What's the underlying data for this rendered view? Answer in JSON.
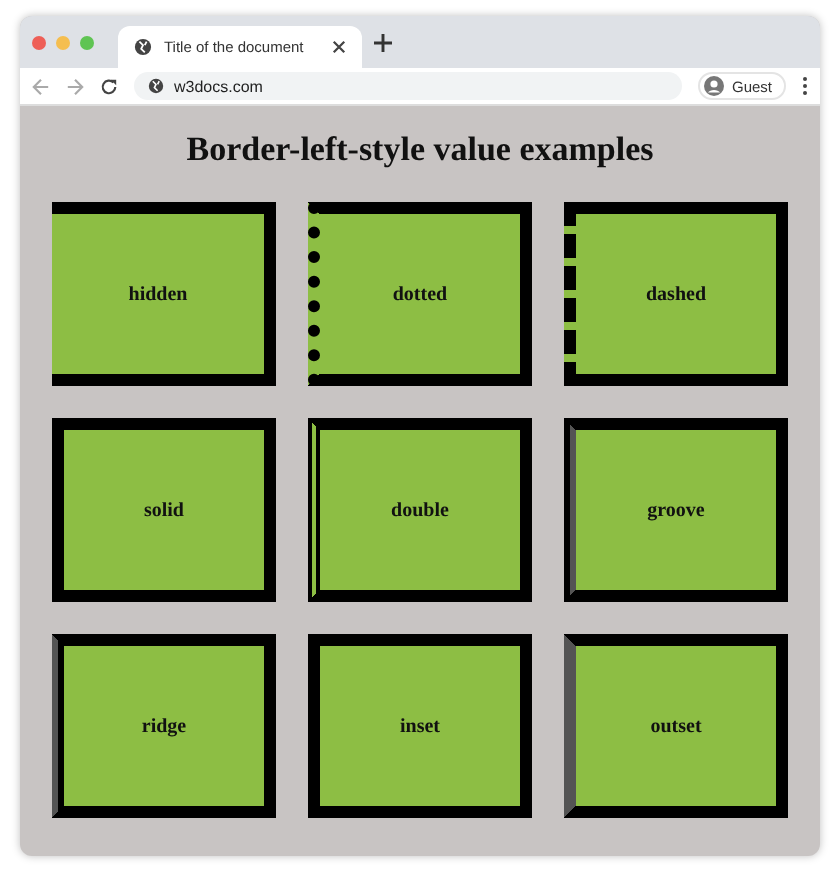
{
  "window": {
    "tab": {
      "title": "Title of the document",
      "selected": true
    },
    "address": "w3docs.com",
    "profile": "Guest"
  },
  "page": {
    "heading": "Border-left-style value examples",
    "boxes": [
      {
        "label": "hidden",
        "kind": "hidden"
      },
      {
        "label": "dotted",
        "kind": "dotted"
      },
      {
        "label": "dashed",
        "kind": "dashed"
      },
      {
        "label": "solid",
        "kind": "solid"
      },
      {
        "label": "double",
        "kind": "double"
      },
      {
        "label": "groove",
        "kind": "groove"
      },
      {
        "label": "ridge",
        "kind": "ridge"
      },
      {
        "label": "inset",
        "kind": "inset"
      },
      {
        "label": "outset",
        "kind": "outset"
      }
    ]
  }
}
